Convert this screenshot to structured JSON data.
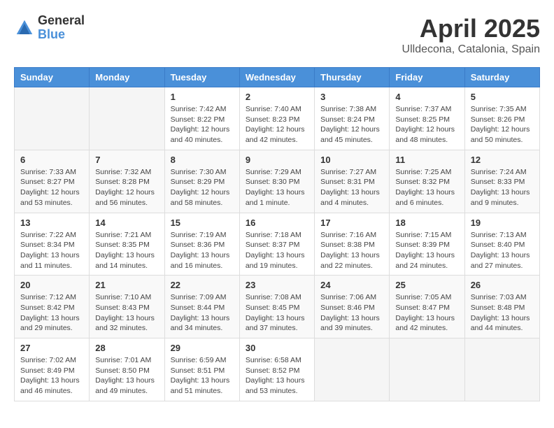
{
  "header": {
    "logo_general": "General",
    "logo_blue": "Blue",
    "title": "April 2025",
    "subtitle": "Ulldecona, Catalonia, Spain"
  },
  "days_of_week": [
    "Sunday",
    "Monday",
    "Tuesday",
    "Wednesday",
    "Thursday",
    "Friday",
    "Saturday"
  ],
  "weeks": [
    [
      {
        "day": "",
        "sunrise": "",
        "sunset": "",
        "daylight": "",
        "empty": true
      },
      {
        "day": "",
        "sunrise": "",
        "sunset": "",
        "daylight": "",
        "empty": true
      },
      {
        "day": "1",
        "sunrise": "Sunrise: 7:42 AM",
        "sunset": "Sunset: 8:22 PM",
        "daylight": "Daylight: 12 hours and 40 minutes."
      },
      {
        "day": "2",
        "sunrise": "Sunrise: 7:40 AM",
        "sunset": "Sunset: 8:23 PM",
        "daylight": "Daylight: 12 hours and 42 minutes."
      },
      {
        "day": "3",
        "sunrise": "Sunrise: 7:38 AM",
        "sunset": "Sunset: 8:24 PM",
        "daylight": "Daylight: 12 hours and 45 minutes."
      },
      {
        "day": "4",
        "sunrise": "Sunrise: 7:37 AM",
        "sunset": "Sunset: 8:25 PM",
        "daylight": "Daylight: 12 hours and 48 minutes."
      },
      {
        "day": "5",
        "sunrise": "Sunrise: 7:35 AM",
        "sunset": "Sunset: 8:26 PM",
        "daylight": "Daylight: 12 hours and 50 minutes."
      }
    ],
    [
      {
        "day": "6",
        "sunrise": "Sunrise: 7:33 AM",
        "sunset": "Sunset: 8:27 PM",
        "daylight": "Daylight: 12 hours and 53 minutes."
      },
      {
        "day": "7",
        "sunrise": "Sunrise: 7:32 AM",
        "sunset": "Sunset: 8:28 PM",
        "daylight": "Daylight: 12 hours and 56 minutes."
      },
      {
        "day": "8",
        "sunrise": "Sunrise: 7:30 AM",
        "sunset": "Sunset: 8:29 PM",
        "daylight": "Daylight: 12 hours and 58 minutes."
      },
      {
        "day": "9",
        "sunrise": "Sunrise: 7:29 AM",
        "sunset": "Sunset: 8:30 PM",
        "daylight": "Daylight: 13 hours and 1 minute."
      },
      {
        "day": "10",
        "sunrise": "Sunrise: 7:27 AM",
        "sunset": "Sunset: 8:31 PM",
        "daylight": "Daylight: 13 hours and 4 minutes."
      },
      {
        "day": "11",
        "sunrise": "Sunrise: 7:25 AM",
        "sunset": "Sunset: 8:32 PM",
        "daylight": "Daylight: 13 hours and 6 minutes."
      },
      {
        "day": "12",
        "sunrise": "Sunrise: 7:24 AM",
        "sunset": "Sunset: 8:33 PM",
        "daylight": "Daylight: 13 hours and 9 minutes."
      }
    ],
    [
      {
        "day": "13",
        "sunrise": "Sunrise: 7:22 AM",
        "sunset": "Sunset: 8:34 PM",
        "daylight": "Daylight: 13 hours and 11 minutes."
      },
      {
        "day": "14",
        "sunrise": "Sunrise: 7:21 AM",
        "sunset": "Sunset: 8:35 PM",
        "daylight": "Daylight: 13 hours and 14 minutes."
      },
      {
        "day": "15",
        "sunrise": "Sunrise: 7:19 AM",
        "sunset": "Sunset: 8:36 PM",
        "daylight": "Daylight: 13 hours and 16 minutes."
      },
      {
        "day": "16",
        "sunrise": "Sunrise: 7:18 AM",
        "sunset": "Sunset: 8:37 PM",
        "daylight": "Daylight: 13 hours and 19 minutes."
      },
      {
        "day": "17",
        "sunrise": "Sunrise: 7:16 AM",
        "sunset": "Sunset: 8:38 PM",
        "daylight": "Daylight: 13 hours and 22 minutes."
      },
      {
        "day": "18",
        "sunrise": "Sunrise: 7:15 AM",
        "sunset": "Sunset: 8:39 PM",
        "daylight": "Daylight: 13 hours and 24 minutes."
      },
      {
        "day": "19",
        "sunrise": "Sunrise: 7:13 AM",
        "sunset": "Sunset: 8:40 PM",
        "daylight": "Daylight: 13 hours and 27 minutes."
      }
    ],
    [
      {
        "day": "20",
        "sunrise": "Sunrise: 7:12 AM",
        "sunset": "Sunset: 8:42 PM",
        "daylight": "Daylight: 13 hours and 29 minutes."
      },
      {
        "day": "21",
        "sunrise": "Sunrise: 7:10 AM",
        "sunset": "Sunset: 8:43 PM",
        "daylight": "Daylight: 13 hours and 32 minutes."
      },
      {
        "day": "22",
        "sunrise": "Sunrise: 7:09 AM",
        "sunset": "Sunset: 8:44 PM",
        "daylight": "Daylight: 13 hours and 34 minutes."
      },
      {
        "day": "23",
        "sunrise": "Sunrise: 7:08 AM",
        "sunset": "Sunset: 8:45 PM",
        "daylight": "Daylight: 13 hours and 37 minutes."
      },
      {
        "day": "24",
        "sunrise": "Sunrise: 7:06 AM",
        "sunset": "Sunset: 8:46 PM",
        "daylight": "Daylight: 13 hours and 39 minutes."
      },
      {
        "day": "25",
        "sunrise": "Sunrise: 7:05 AM",
        "sunset": "Sunset: 8:47 PM",
        "daylight": "Daylight: 13 hours and 42 minutes."
      },
      {
        "day": "26",
        "sunrise": "Sunrise: 7:03 AM",
        "sunset": "Sunset: 8:48 PM",
        "daylight": "Daylight: 13 hours and 44 minutes."
      }
    ],
    [
      {
        "day": "27",
        "sunrise": "Sunrise: 7:02 AM",
        "sunset": "Sunset: 8:49 PM",
        "daylight": "Daylight: 13 hours and 46 minutes."
      },
      {
        "day": "28",
        "sunrise": "Sunrise: 7:01 AM",
        "sunset": "Sunset: 8:50 PM",
        "daylight": "Daylight: 13 hours and 49 minutes."
      },
      {
        "day": "29",
        "sunrise": "Sunrise: 6:59 AM",
        "sunset": "Sunset: 8:51 PM",
        "daylight": "Daylight: 13 hours and 51 minutes."
      },
      {
        "day": "30",
        "sunrise": "Sunrise: 6:58 AM",
        "sunset": "Sunset: 8:52 PM",
        "daylight": "Daylight: 13 hours and 53 minutes."
      },
      {
        "day": "",
        "sunrise": "",
        "sunset": "",
        "daylight": "",
        "empty": true
      },
      {
        "day": "",
        "sunrise": "",
        "sunset": "",
        "daylight": "",
        "empty": true
      },
      {
        "day": "",
        "sunrise": "",
        "sunset": "",
        "daylight": "",
        "empty": true
      }
    ]
  ]
}
